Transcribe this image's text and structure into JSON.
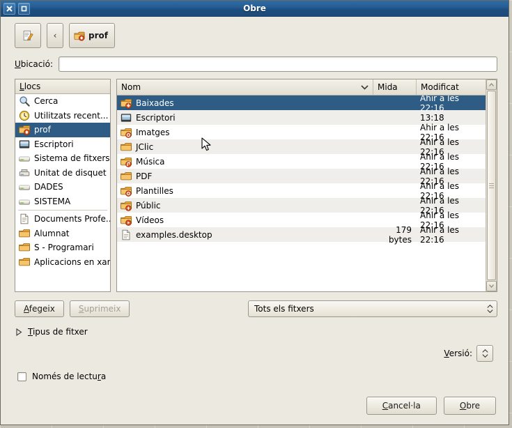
{
  "window": {
    "title": "Obre",
    "close_label": "✕",
    "maximize_label": "□"
  },
  "toolbar": {
    "edit_button_name": "type-a-file-name",
    "back_label": "‹",
    "path_button_label": "prof"
  },
  "location": {
    "label": "Ubicació:",
    "value": "",
    "placeholder": ""
  },
  "sidebar": {
    "header": "Llocs",
    "items": [
      {
        "label": "Cerca",
        "icon": "search-icon",
        "selected": false
      },
      {
        "label": "Utilitzats recent...",
        "icon": "recent-icon",
        "selected": false
      },
      {
        "label": "prof",
        "icon": "home-folder-icon",
        "selected": true
      },
      {
        "label": "Escriptori",
        "icon": "desktop-icon",
        "selected": false
      },
      {
        "label": "Sistema de fitxers",
        "icon": "drive-icon",
        "selected": false
      },
      {
        "label": "Unitat de disquet",
        "icon": "floppy-icon",
        "selected": false
      },
      {
        "label": "DADES",
        "icon": "drive-icon",
        "selected": false
      },
      {
        "label": "SISTEMA",
        "icon": "drive-icon",
        "selected": false
      },
      {
        "label": "Documents Profe...",
        "icon": "document-icon",
        "selected": false,
        "after_separator": true
      },
      {
        "label": "Alumnat",
        "icon": "folder-icon",
        "selected": false
      },
      {
        "label": "S - Programari",
        "icon": "folder-icon",
        "selected": false
      },
      {
        "label": "Aplicacions en xarxa",
        "icon": "folder-icon",
        "selected": false
      }
    ]
  },
  "filelist": {
    "columns": {
      "name": "Nom",
      "size": "Mida",
      "modified": "Modificat"
    },
    "sort_indicator": "chevron-down-icon",
    "rows": [
      {
        "name": "Baixades",
        "icon": "download-folder-icon",
        "size": "",
        "modified": "Ahir a les 22:16",
        "selected": true
      },
      {
        "name": "Escriptori",
        "icon": "desktop-icon",
        "size": "",
        "modified": "13:18",
        "selected": false
      },
      {
        "name": "Imatges",
        "icon": "pictures-folder-icon",
        "size": "",
        "modified": "Ahir a les 22:16",
        "selected": false
      },
      {
        "name": "JClic",
        "icon": "folder-icon",
        "size": "",
        "modified": "Ahir a les 22:16",
        "selected": false
      },
      {
        "name": "Música",
        "icon": "music-folder-icon",
        "size": "",
        "modified": "Ahir a les 22:16",
        "selected": false
      },
      {
        "name": "PDF",
        "icon": "folder-icon",
        "size": "",
        "modified": "Ahir a les 22:16",
        "selected": false
      },
      {
        "name": "Plantilles",
        "icon": "templates-folder-icon",
        "size": "",
        "modified": "Ahir a les 22:16",
        "selected": false
      },
      {
        "name": "Públic",
        "icon": "public-folder-icon",
        "size": "",
        "modified": "Ahir a les 22:16",
        "selected": false
      },
      {
        "name": "Vídeos",
        "icon": "videos-folder-icon",
        "size": "",
        "modified": "Ahir a les 22:16",
        "selected": false
      },
      {
        "name": "examples.desktop",
        "icon": "file-icon",
        "size": "179 bytes",
        "modified": "Ahir a les 22:16",
        "selected": false
      }
    ]
  },
  "bottom": {
    "add_label": "Afegeix",
    "remove_label": "Suprimeix",
    "remove_disabled": true,
    "filter_value": "Tots els fitxers",
    "expander_label": "Tipus de fitxer",
    "expander_expanded": false,
    "version_label": "Versió:",
    "version_value": "",
    "readonly_label": "Només de lectura",
    "readonly_checked": false,
    "cancel_label": "Cancel·la",
    "open_label": "Obre"
  },
  "colors": {
    "titlebar": "#255d93",
    "selection": "#2e5c85",
    "window_bg": "#ece9e1",
    "folder_orange": "#e8a33d",
    "accent_red": "#d94d1a"
  }
}
